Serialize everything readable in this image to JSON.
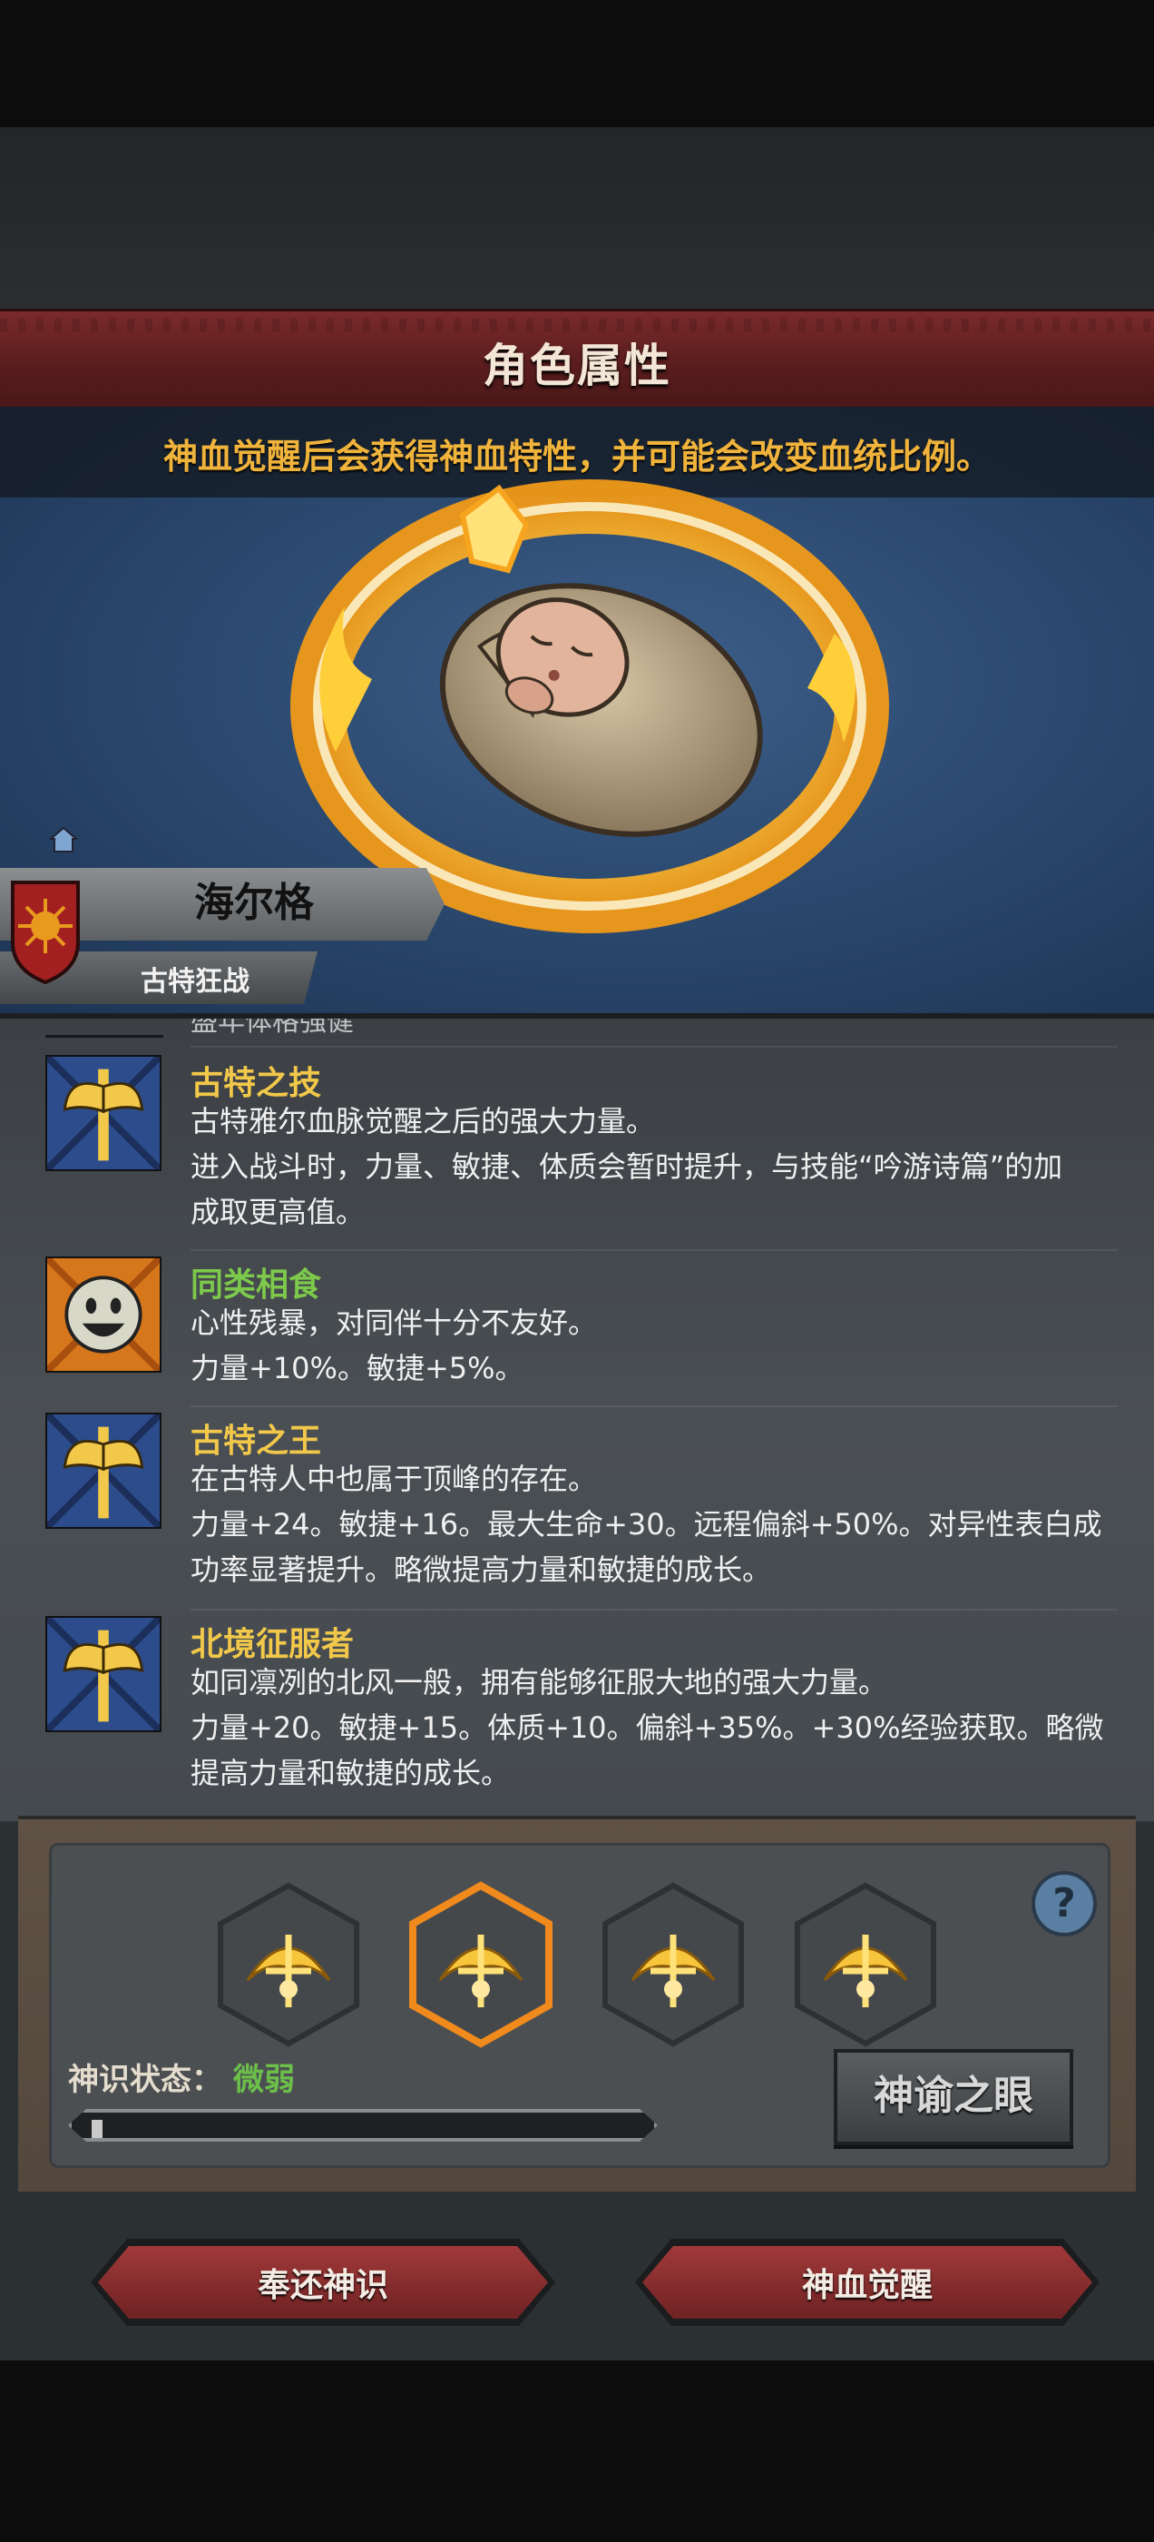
{
  "header": {
    "title": "角色属性"
  },
  "notice": "神血觉醒后会获得神血特性，并可能会改变血统比例。",
  "character": {
    "name": "海尔格",
    "class": "古特狂战"
  },
  "traits_header_partial": "盛年体格强健",
  "traits": [
    {
      "name": "古特之技",
      "name_color": "#f2c84a",
      "icon": "golden-axe-icon",
      "lines": [
        "古特雅尔血脉觉醒之后的强大力量。",
        "进入战斗时，力量、敏捷、体质会暂时提升，与技能“吟游诗篇”的加",
        "成取更高值。"
      ]
    },
    {
      "name": "同类相食",
      "name_color": "#7cc94b",
      "icon": "grinning-face-icon",
      "lines": [
        "心性残暴，对同伴十分不友好。",
        "力量+10%。敏捷+5%。"
      ]
    },
    {
      "name": "古特之王",
      "name_color": "#f2c84a",
      "icon": "golden-axe-icon",
      "lines": [
        "在古特人中也属于顶峰的存在。",
        "力量+24。敏捷+16。最大生命+30。远程偏斜+50%。对异性表白成",
        "功率显著提升。略微提高力量和敏捷的成长。"
      ]
    },
    {
      "name": "北境征服者",
      "name_color": "#f2c84a",
      "icon": "golden-axe-icon",
      "lines": [
        "如同凛冽的北风一般，拥有能够征服大地的强大力量。",
        "力量+20。敏捷+15。体质+10。偏斜+35%。+30%经验获取。略微",
        "提高力量和敏捷的成长。"
      ]
    }
  ],
  "runes": [
    {
      "icon": "divine-rune-icon",
      "selected": false
    },
    {
      "icon": "divine-rune-icon",
      "selected": true
    },
    {
      "icon": "divine-rune-icon",
      "selected": false
    },
    {
      "icon": "divine-rune-icon",
      "selected": false
    }
  ],
  "status": {
    "label": "神识状态：",
    "value": "微弱",
    "value_color": "#6cc04a",
    "progress": 0.02
  },
  "buttons": {
    "help": "?",
    "eye": "神谕之眼",
    "return": "奉还神识",
    "awaken": "神血觉醒"
  },
  "colors": {
    "accent_red": "#8a2c2d",
    "selected_orange": "#f08a1c"
  }
}
